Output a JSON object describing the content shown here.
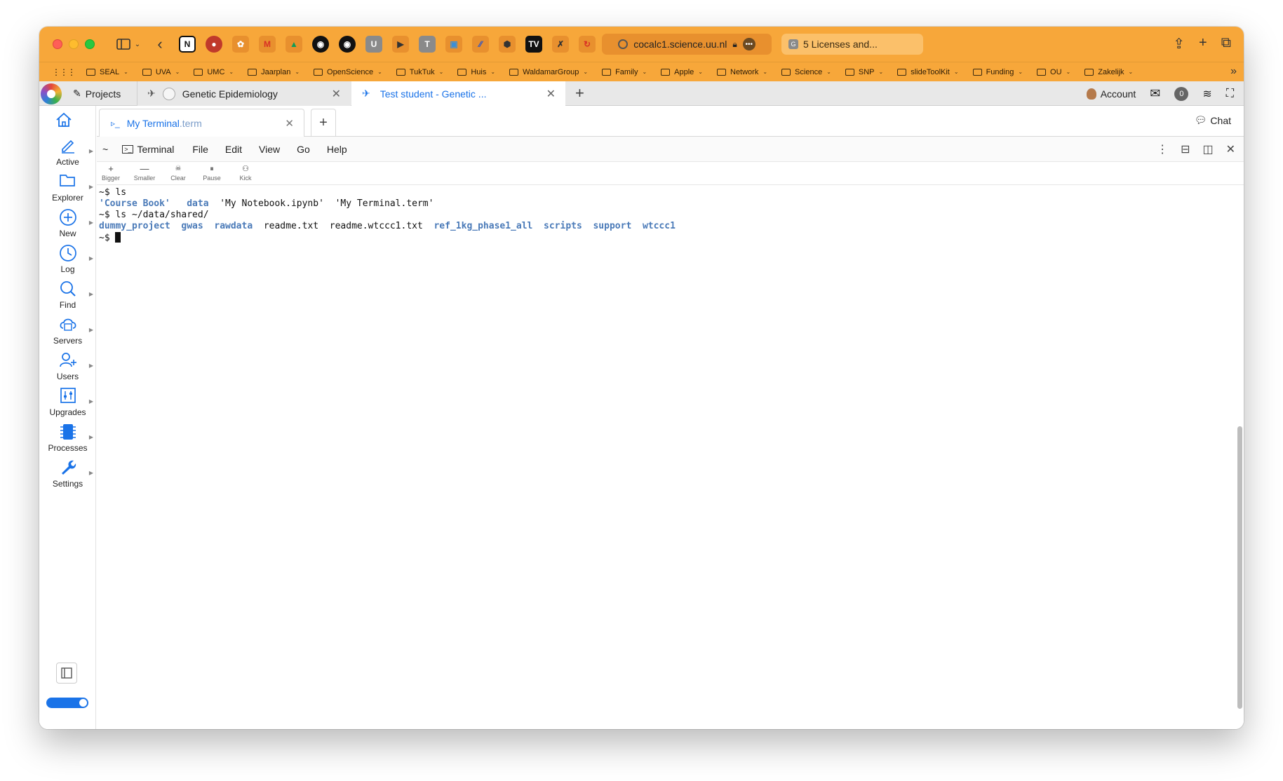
{
  "browser": {
    "url": "cocalc1.science.uu.nl",
    "second_tab": "5 Licenses and...",
    "bookmarks": [
      {
        "label": "SEAL"
      },
      {
        "label": "UVA"
      },
      {
        "label": "UMC"
      },
      {
        "label": "Jaarplan"
      },
      {
        "label": "OpenScience"
      },
      {
        "label": "TukTuk"
      },
      {
        "label": "Huis"
      },
      {
        "label": "WaldamarGroup"
      },
      {
        "label": "Family"
      },
      {
        "label": "Apple"
      },
      {
        "label": "Network"
      },
      {
        "label": "Science"
      },
      {
        "label": "SNP"
      },
      {
        "label": "slideToolKit"
      },
      {
        "label": "Funding"
      },
      {
        "label": "OU"
      },
      {
        "label": "Zakelijk"
      }
    ],
    "accent_color": "#f7a73a"
  },
  "app": {
    "projects_label": "Projects",
    "tabs": [
      {
        "label": "Genetic Epidemiology"
      },
      {
        "label": "Test student - Genetic ..."
      }
    ],
    "account_label": "Account",
    "notification_count": "0"
  },
  "sidebar": {
    "items": [
      {
        "label": "Active",
        "icon": "pencil-icon"
      },
      {
        "label": "Explorer",
        "icon": "folder-icon"
      },
      {
        "label": "New",
        "icon": "plus-circle-icon"
      },
      {
        "label": "Log",
        "icon": "clock-icon"
      },
      {
        "label": "Find",
        "icon": "search-icon"
      },
      {
        "label": "Servers",
        "icon": "cloud-server-icon"
      },
      {
        "label": "Users",
        "icon": "users-icon"
      },
      {
        "label": "Upgrades",
        "icon": "sliders-icon"
      },
      {
        "label": "Processes",
        "icon": "processor-icon"
      },
      {
        "label": "Settings",
        "icon": "wrench-icon"
      }
    ]
  },
  "file_tab": {
    "name": "My Terminal",
    "ext": ".term"
  },
  "chat_label": "Chat",
  "menubar": {
    "tilde": "~",
    "terminal": "Terminal",
    "items": [
      "File",
      "Edit",
      "View",
      "Go",
      "Help"
    ]
  },
  "buttons": [
    "Bigger",
    "Smaller",
    "Clear",
    "Pause",
    "Kick"
  ],
  "terminal": {
    "line1": "~$ ls",
    "line2": {
      "course_book": "'Course Book'",
      "data": "data",
      "notebook": "'My Notebook.ipynb'",
      "term": "'My Terminal.term'"
    },
    "line3": "~$ ls ~/data/shared/",
    "line4": {
      "dummy_project": "dummy_project",
      "gwas": "gwas",
      "rawdata": "rawdata",
      "readme": "readme.txt",
      "readme_wtccc1": "readme.wtccc1.txt",
      "ref": "ref_1kg_phase1_all",
      "scripts": "scripts",
      "support": "support",
      "wtccc1": "wtccc1"
    },
    "prompt": "~$ "
  }
}
